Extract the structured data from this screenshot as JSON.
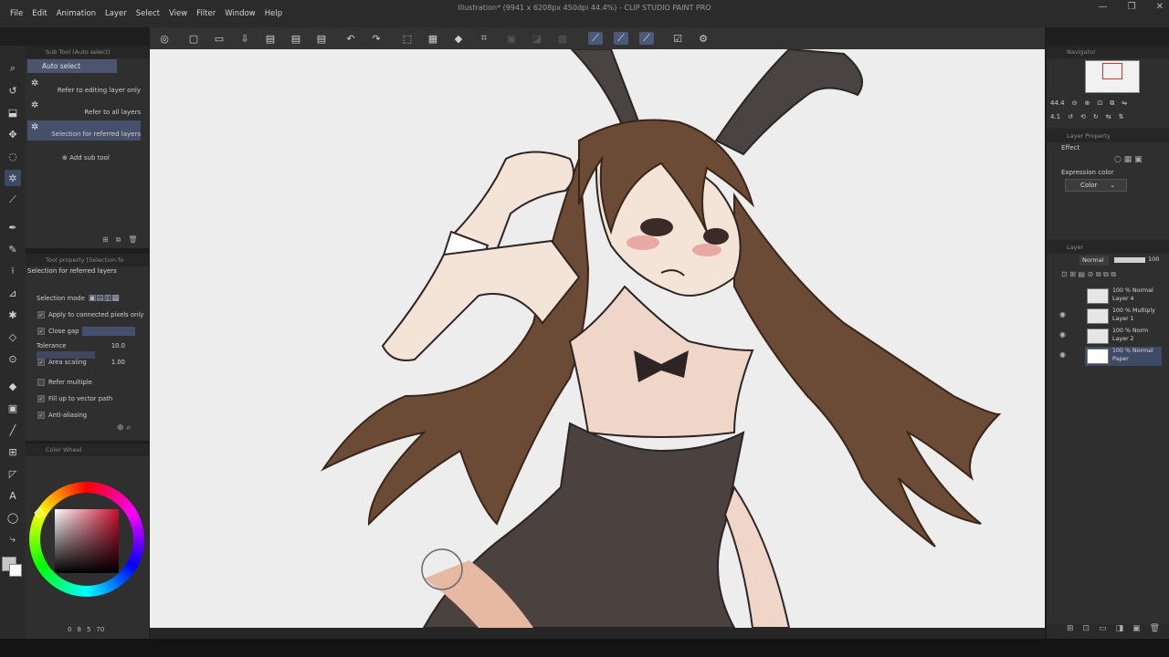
{
  "window": {
    "title": "Illustration* (9941 x 6208px 450dpi 44.4%) - CLIP STUDIO PAINT PRO"
  },
  "menu": [
    "File",
    "Edit",
    "Animation",
    "Layer",
    "Select",
    "View",
    "Filter",
    "Window",
    "Help"
  ],
  "subtool_panel": {
    "header": "Sub Tool (Auto select)",
    "active_tab": "Auto select",
    "items": [
      {
        "label": "Refer to editing layer only"
      },
      {
        "label": "Refer to all layers"
      },
      {
        "label": "Selection for referred layers"
      }
    ],
    "add_label": "Add sub tool"
  },
  "tool_property": {
    "header": "Tool property [Selection fo",
    "subtitle": "Selection for referred layers",
    "selection_mode_label": "Selection mode",
    "apply_connected_label": "Apply to connected pixels only",
    "close_gap_label": "Close gap",
    "tolerance_label": "Tolerance",
    "tolerance_value": "10.0",
    "area_scaling_label": "Area scaling",
    "area_scaling_value": "1.00",
    "refer_multiple_label": "Refer multiple",
    "fill_vector_label": "Fill up to vector path",
    "anti_alias_label": "Anti-aliasing"
  },
  "color_wheel": {
    "header": "Color Wheel",
    "footer": [
      "0",
      "8",
      "5",
      "70"
    ]
  },
  "navigator": {
    "header": "Navigator",
    "zoom_value": "44.4",
    "rotate_value": "4.1"
  },
  "layer_property": {
    "header": "Layer Property",
    "effect_label": "Effect",
    "expression_color_label": "Expression color",
    "expression_color_value": "Color"
  },
  "layer_panel": {
    "header": "Layer",
    "blend_mode": "Normal",
    "opacity": "100",
    "layers": [
      {
        "line1": "100 % Normal",
        "line2": "Layer 4"
      },
      {
        "line1": "100 % Multiply",
        "line2": "Layer 1"
      },
      {
        "line1": "100 % Norm",
        "line2": "Layer 2"
      },
      {
        "line1": "100 % Normal",
        "line2": "Paper"
      }
    ]
  },
  "icons": {
    "accent": "#4b5570"
  }
}
